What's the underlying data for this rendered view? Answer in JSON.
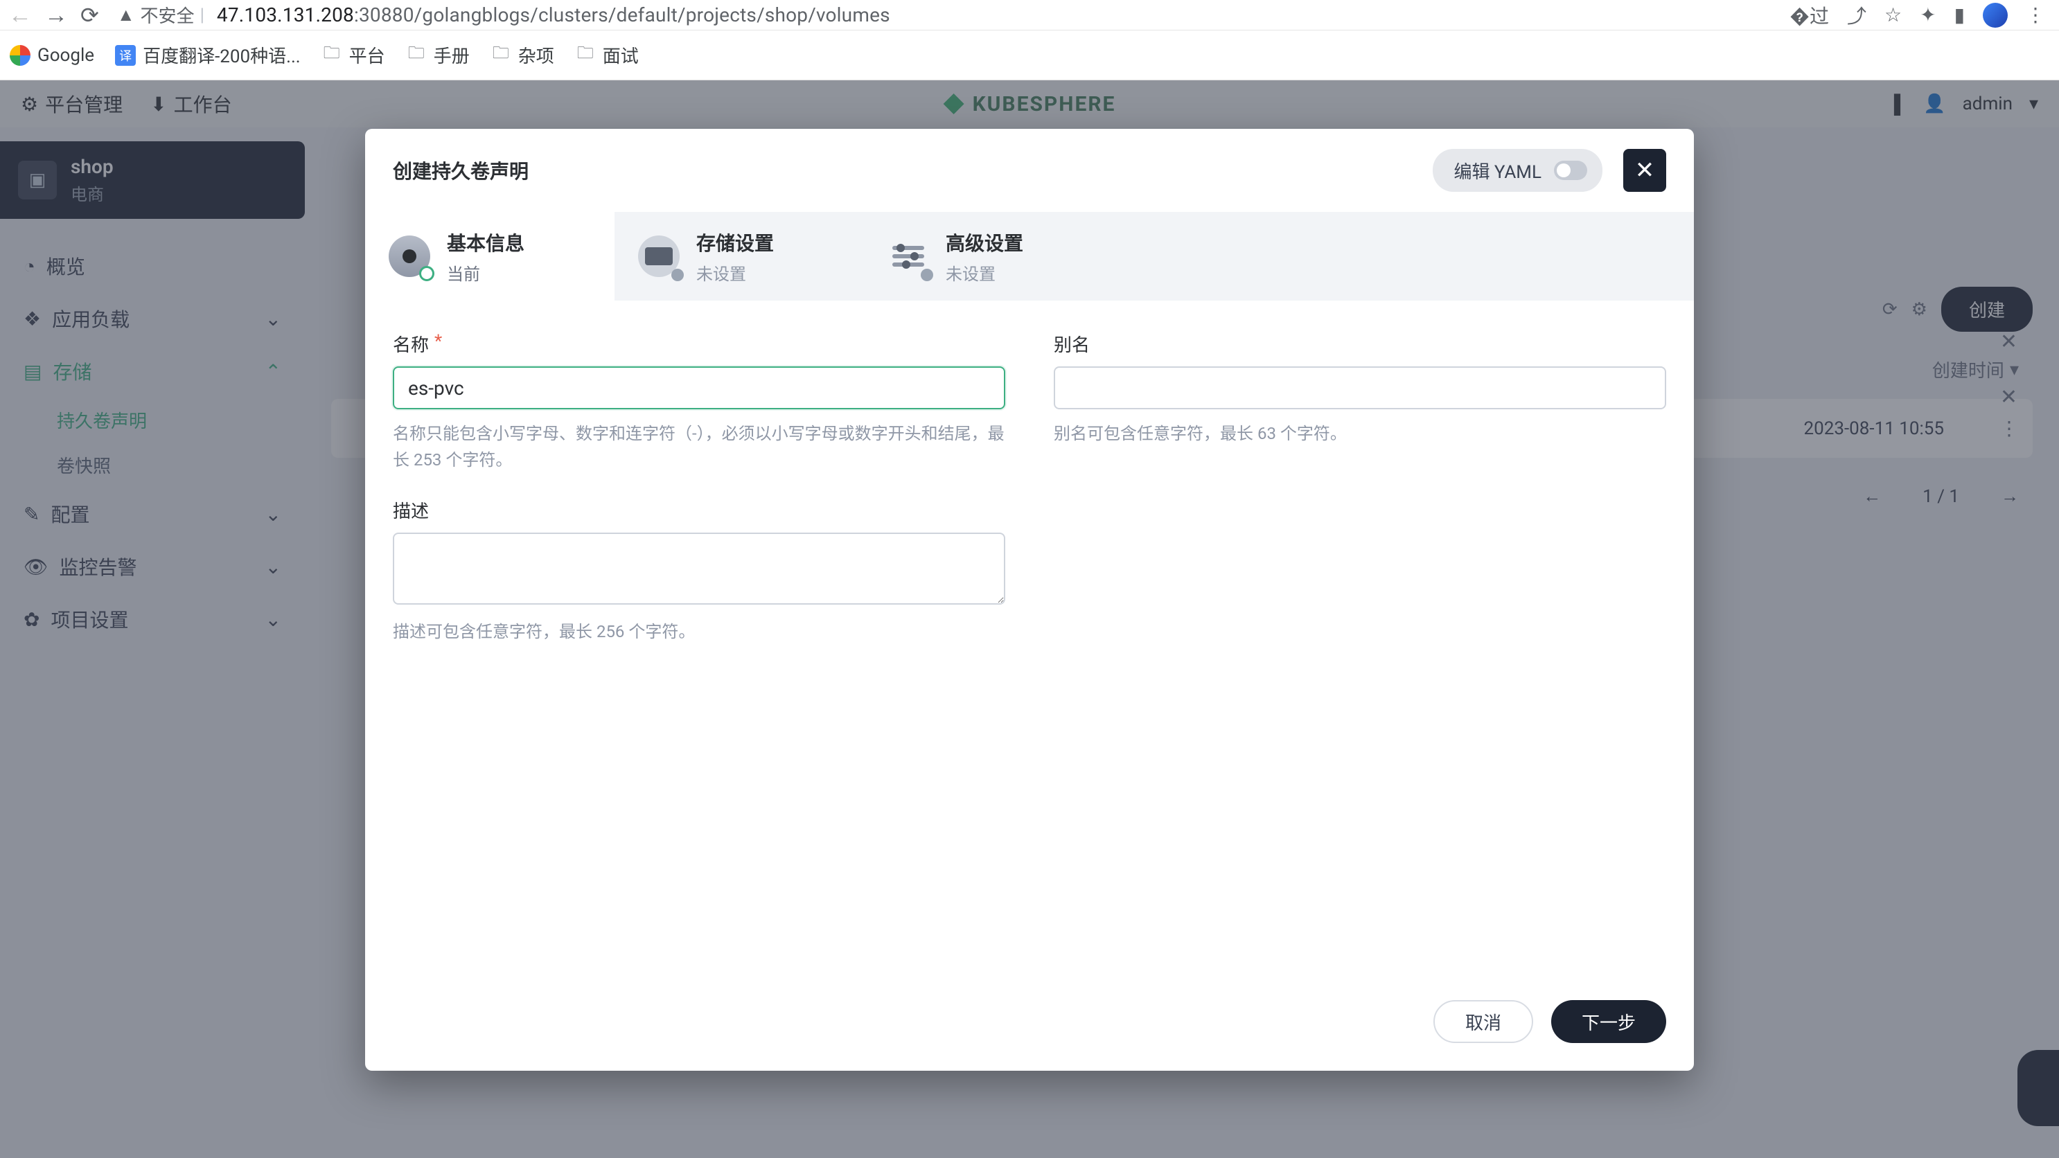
{
  "browser": {
    "insecure_label": "不安全",
    "url_host": "47.103.131.208",
    "url_path": ":30880/golangblogs/clusters/default/projects/shop/volumes"
  },
  "bookmarks": [
    {
      "label": "Google",
      "icon": "google"
    },
    {
      "label": "百度翻译-200种语...",
      "icon": "translate"
    },
    {
      "label": "平台",
      "icon": "folder"
    },
    {
      "label": "手册",
      "icon": "folder"
    },
    {
      "label": "杂项",
      "icon": "folder"
    },
    {
      "label": "面试",
      "icon": "folder"
    }
  ],
  "topnav": {
    "platform": "平台管理",
    "workbench": "工作台",
    "brand": "KUBESPHERE",
    "user": "admin"
  },
  "project": {
    "name": "shop",
    "subtitle": "电商"
  },
  "sidebar": {
    "overview": "概览",
    "workloads": "应用负载",
    "storage": "存储",
    "storage_items": {
      "pvc": "持久卷声明",
      "snapshot": "卷快照"
    },
    "config": "配置",
    "monitor": "监控告警",
    "project_settings": "项目设置"
  },
  "main": {
    "create_btn": "创建",
    "col_created": "创建时间",
    "row_created": "2023-08-11 10:55",
    "pager": "1 / 1"
  },
  "modal": {
    "title": "创建持久卷声明",
    "yaml_label": "编辑 YAML",
    "steps": {
      "basic": {
        "title": "基本信息",
        "sub": "当前"
      },
      "storage": {
        "title": "存储设置",
        "sub": "未设置"
      },
      "advanced": {
        "title": "高级设置",
        "sub": "未设置"
      }
    },
    "form": {
      "name_label": "名称",
      "name_value": "es-pvc",
      "name_help": "名称只能包含小写字母、数字和连字符（-），必须以小写字母或数字开头和结尾，最长 253 个字符。",
      "alias_label": "别名",
      "alias_help": "别名可包含任意字符，最长 63 个字符。",
      "desc_label": "描述",
      "desc_help": "描述可包含任意字符，最长 256 个字符。"
    },
    "footer": {
      "cancel": "取消",
      "next": "下一步"
    }
  }
}
